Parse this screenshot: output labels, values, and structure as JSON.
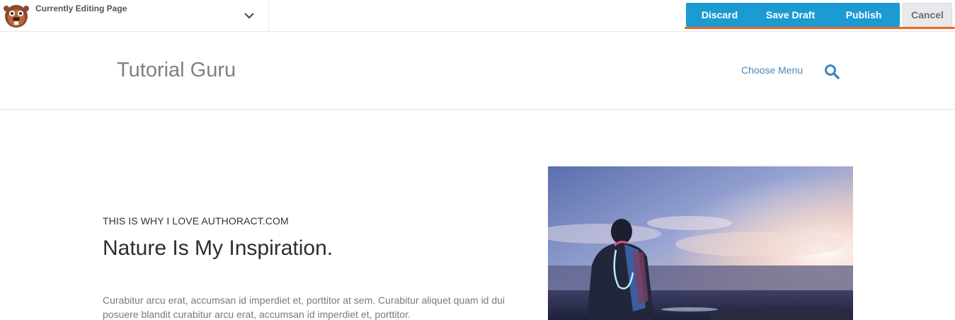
{
  "builder": {
    "editing_label": "Currently Editing Page",
    "actions": {
      "discard": "Discard",
      "save_draft": "Save Draft",
      "publish": "Publish",
      "cancel": "Cancel"
    },
    "colors": {
      "primary": "#1b9bd1",
      "accent": "#f16522"
    }
  },
  "site": {
    "title": "Tutorial Guru",
    "menu_label": "Choose Menu",
    "search_icon": "search-icon"
  },
  "content": {
    "eyebrow": "THIS IS WHY I LOVE AUTHORACT.COM",
    "heading": "Nature Is My Inspiration.",
    "body": "Curabitur arcu erat, accumsan id imperdiet et, porttitor at sem. Curabitur aliquet quam id dui posuere blandit curabitur arcu erat, accumsan id imperdiet et, porttitor."
  }
}
